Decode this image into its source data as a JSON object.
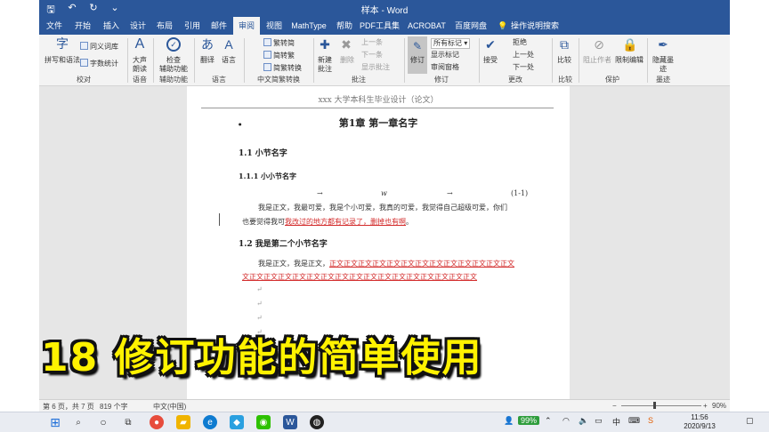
{
  "window": {
    "title": "样本 - Word",
    "qat": {
      "save": "🖫",
      "undo": "↶",
      "redo": "↻",
      "more": "⌄"
    }
  },
  "tabs": [
    {
      "label": "文件"
    },
    {
      "label": "开始"
    },
    {
      "label": "插入"
    },
    {
      "label": "设计"
    },
    {
      "label": "布局"
    },
    {
      "label": "引用"
    },
    {
      "label": "邮件"
    },
    {
      "label": "审阅",
      "active": true
    },
    {
      "label": "视图"
    },
    {
      "label": "MathType"
    },
    {
      "label": "帮助"
    },
    {
      "label": "PDF工具集"
    },
    {
      "label": "ACROBAT"
    },
    {
      "label": "百度网盘"
    },
    {
      "label": "操作说明搜索"
    }
  ],
  "ribbon": {
    "proofing": {
      "spell": "拼写和语法",
      "thesaurus": "同义词库",
      "wordcount": "字数统计",
      "group": "校对"
    },
    "speech": {
      "read_aloud": "大声\n朗读",
      "group": "语音"
    },
    "accessibility": {
      "check": "检查\n辅助功能",
      "group": "辅助功能"
    },
    "language": {
      "translate": "翻译",
      "language": "语言",
      "group": "语言"
    },
    "chinese": {
      "to_trad": "繁转简",
      "to_simp": "简转繁",
      "convert": "简繁转换",
      "group": "中文简繁转换"
    },
    "comments": {
      "new": "新建\n批注",
      "delete": "删除",
      "prev": "上一条",
      "next": "下一条",
      "show": "显示批注",
      "group": "批注"
    },
    "tracking": {
      "track": "修订",
      "markup": "所有标记",
      "show_markup": "显示标记",
      "pane": "审阅窗格",
      "group": "修订"
    },
    "changes": {
      "accept": "接受",
      "reject": "拒绝",
      "prev": "上一处",
      "next": "下一处",
      "group": "更改"
    },
    "compare": {
      "compare": "比较",
      "group": "比较"
    },
    "protect": {
      "block": "阻止作者",
      "restrict": "限制编辑",
      "group": "保护"
    },
    "ink": {
      "hide": "隐藏墨\n迹",
      "group": "墨迹"
    }
  },
  "document": {
    "header": "xxx 大学本科生毕业设计（论文）",
    "chapter": "第1章  第一章名字",
    "section1": "1.1  小节名字",
    "subsection": "1.1.1  小小节名字",
    "equation_label": "(1-1)",
    "equation_w": "w",
    "para1_line1": "我是正文，我最可爱，我是个小可爱，我真的可爱，我觉得自己超级可爱，你们",
    "para1_line2a": "也要觉得我可",
    "para1_line2b": "我改过的地方都有记录了，删掉也有啊",
    "para1_line2c": "。",
    "section2": "1.2  我是第二个小节名字",
    "para2_line1a": "我是正文，我是正文，",
    "para2_line1b": "正文正文正文正文正文正文正文正文正文正文正文正文正文",
    "para2_line2": "文正文正文正文正文正文正文正文正文正文正文正文正文正文正文正文正文"
  },
  "status": {
    "page": "第 6 页，共 7 页",
    "words": "819 个字",
    "lang": "中文(中国)",
    "zoom": "90%"
  },
  "caption": "18 修订功能的简单使用",
  "taskbar": {
    "battery": "99%",
    "ime": "中",
    "time": "11:56",
    "date": "2020/9/13"
  },
  "colors": {
    "word_blue": "#2b579a",
    "revision_red": "#d32c2c",
    "caption_yellow": "#fff200"
  }
}
